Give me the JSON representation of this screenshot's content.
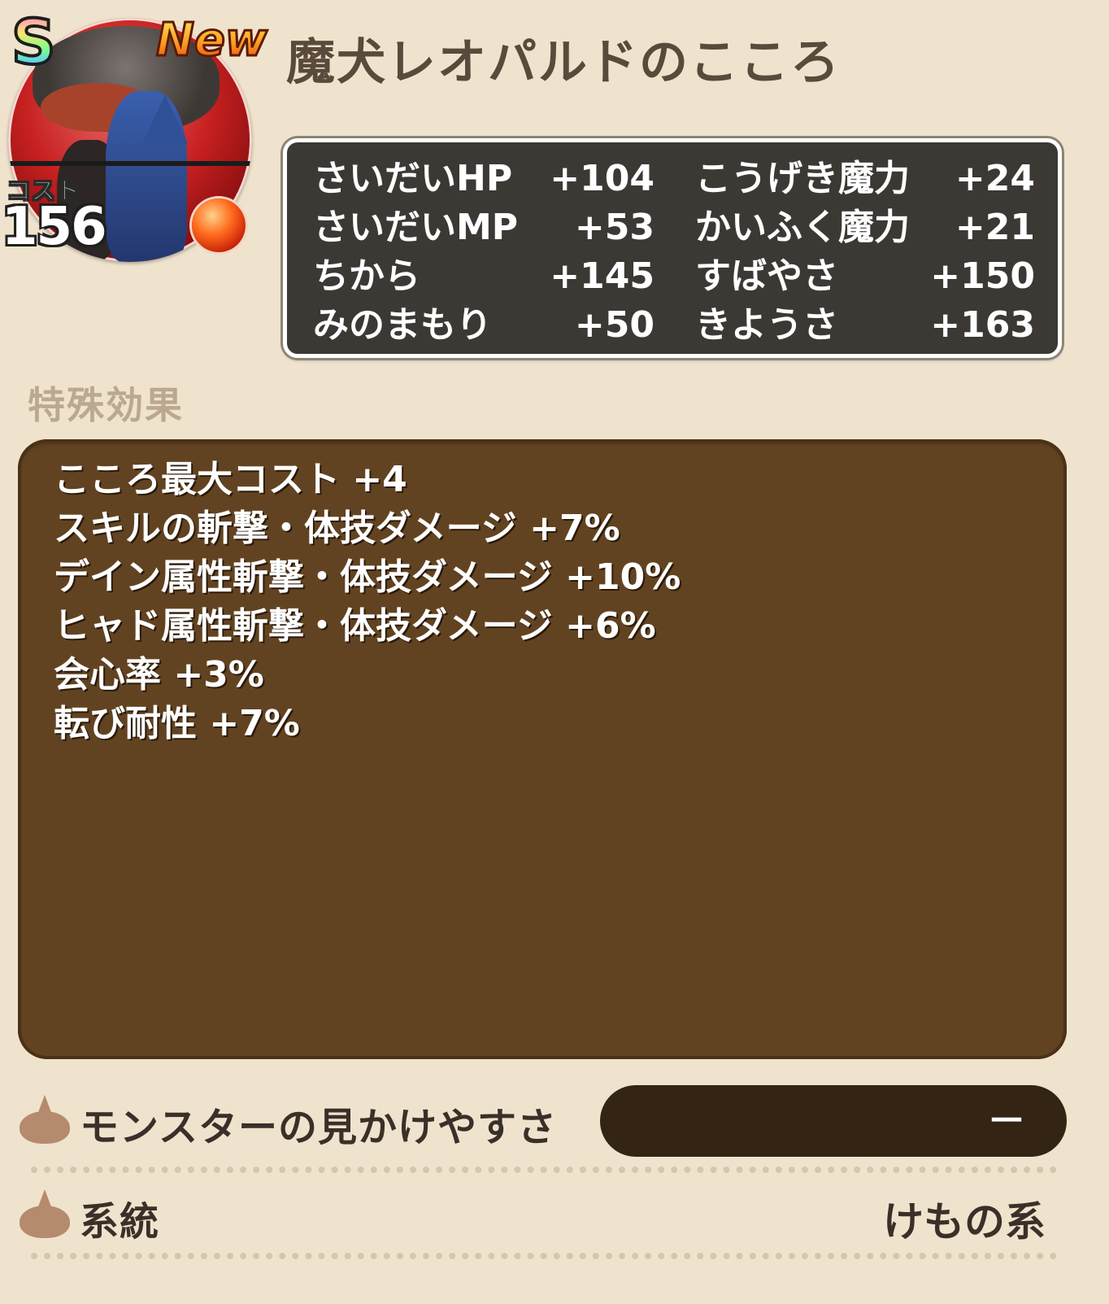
{
  "header": {
    "rank": "S",
    "new_badge": "New",
    "title": "魔犬レオパルドのこころ",
    "cost_label": "コスト",
    "cost_value": "156",
    "element_icon": "fire-orb-icon"
  },
  "stats": [
    {
      "label": "さいだいHP",
      "value": "+104"
    },
    {
      "label": "さいだいMP",
      "value": "+53"
    },
    {
      "label": "ちから",
      "value": "+145"
    },
    {
      "label": "みのまもり",
      "value": "+50"
    },
    {
      "label": "こうげき魔力",
      "value": "+24"
    },
    {
      "label": "かいふく魔力",
      "value": "+21"
    },
    {
      "label": "すばやさ",
      "value": "+150"
    },
    {
      "label": "きようさ",
      "value": "+163"
    }
  ],
  "special_effects": {
    "heading": "特殊効果",
    "items": [
      "こころ最大コスト +4",
      "スキルの斬撃・体技ダメージ +7%",
      "デイン属性斬撃・体技ダメージ +10%",
      "ヒャド属性斬撃・体技ダメージ +6%",
      "会心率 +3%",
      "転び耐性 +7%"
    ]
  },
  "info_rows": {
    "visibility": {
      "label": "モンスターの見かけやすさ",
      "value": "－"
    },
    "family": {
      "label": "系統",
      "value": "けもの系"
    }
  },
  "colors": {
    "background": "#f0e3cd",
    "stats_panel": "#3c3935",
    "effects_panel": "#624321",
    "visibility_bar": "#332413",
    "title_text": "#5a4a3c",
    "heading_text": "#bba891"
  }
}
